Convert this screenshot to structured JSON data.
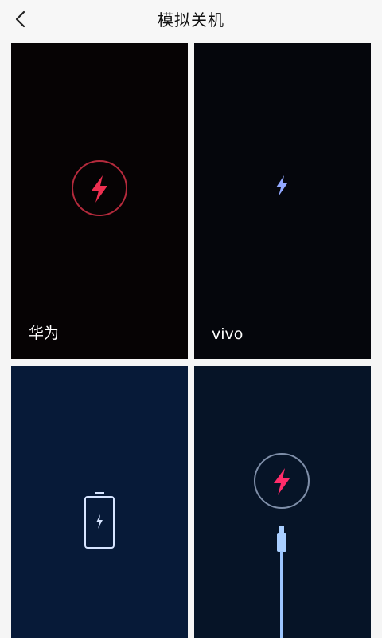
{
  "header": {
    "title": "模拟关机",
    "back_icon": "chevron-left-icon"
  },
  "cards": [
    {
      "label": "华为",
      "accent": "#e8304f",
      "icon": "lightning-in-circle-icon"
    },
    {
      "label": "vivo",
      "accent": "#8fa6ff",
      "icon": "lightning-icon"
    },
    {
      "label": "",
      "accent": "#cfe0ff",
      "icon": "battery-icon"
    },
    {
      "label": "",
      "accent": "#ff2d6a",
      "icon": "charging-cable-icon"
    }
  ]
}
